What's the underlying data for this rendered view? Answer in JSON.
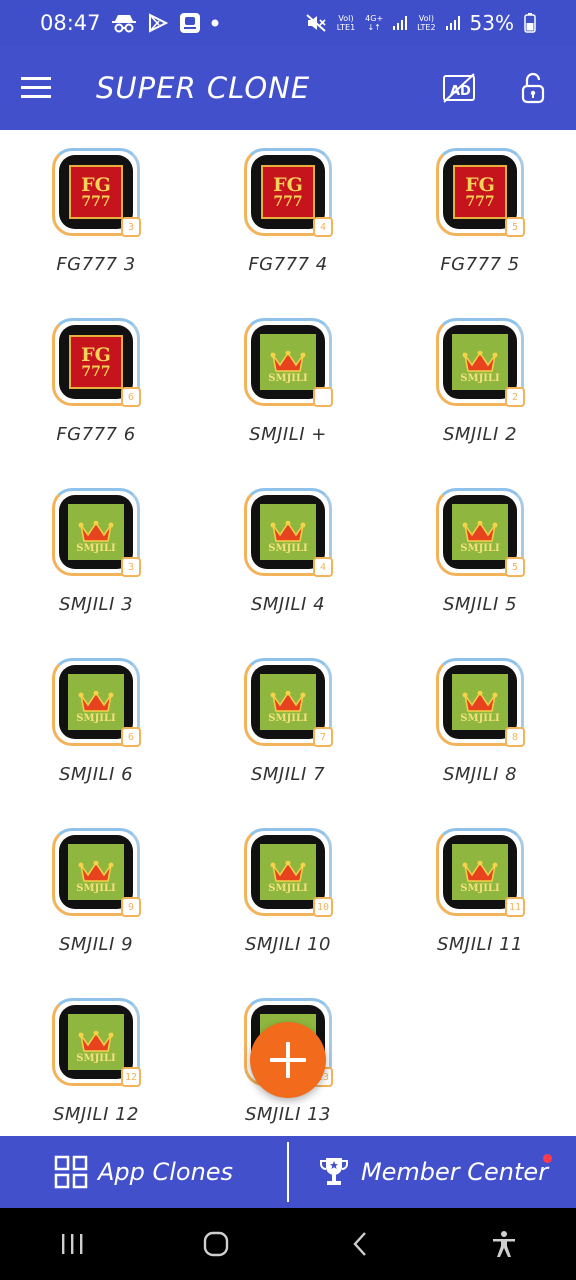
{
  "status_bar": {
    "time": "08:47",
    "left_icons": [
      "incognito-icon",
      "play-store-icon",
      "app-notification-icon",
      "dot-icon"
    ],
    "sim1": [
      "VoI)",
      "LTE1"
    ],
    "net_type": "4G+",
    "sim2": [
      "VoI)",
      "LTE2"
    ],
    "battery": "53%"
  },
  "app_bar": {
    "title": "SUPER CLONE",
    "actions": [
      "no-ads-icon",
      "lock-icon"
    ]
  },
  "apps": [
    {
      "label": "FG777 3",
      "logo": "fg",
      "badge": "3"
    },
    {
      "label": "FG777 4",
      "logo": "fg",
      "badge": "4"
    },
    {
      "label": "FG777 5",
      "logo": "fg",
      "badge": "5"
    },
    {
      "label": "FG777 6",
      "logo": "fg",
      "badge": "6"
    },
    {
      "label": "SMJILI +",
      "logo": "sm",
      "badge": ""
    },
    {
      "label": "SMJILI 2",
      "logo": "sm",
      "badge": "2"
    },
    {
      "label": "SMJILI 3",
      "logo": "sm",
      "badge": "3"
    },
    {
      "label": "SMJILI 4",
      "logo": "sm",
      "badge": "4"
    },
    {
      "label": "SMJILI 5",
      "logo": "sm",
      "badge": "5"
    },
    {
      "label": "SMJILI 6",
      "logo": "sm",
      "badge": "6"
    },
    {
      "label": "SMJILI 7",
      "logo": "sm",
      "badge": "7"
    },
    {
      "label": "SMJILI 8",
      "logo": "sm",
      "badge": "8"
    },
    {
      "label": "SMJILI 9",
      "logo": "sm",
      "badge": "9"
    },
    {
      "label": "SMJILI 10",
      "logo": "sm",
      "badge": "10"
    },
    {
      "label": "SMJILI 11",
      "logo": "sm",
      "badge": "11"
    },
    {
      "label": "SMJILI 12",
      "logo": "sm",
      "badge": "12"
    },
    {
      "label": "SMJILI 13",
      "logo": "sm",
      "badge": "13"
    }
  ],
  "logos": {
    "fg": {
      "line1": "FG",
      "line2": "777"
    },
    "sm": {
      "text": "SMJILI"
    }
  },
  "fab": {
    "icon": "plus-icon"
  },
  "bottom_nav": {
    "app_clones": {
      "label": "App Clones",
      "icon": "grid-icon"
    },
    "member_center": {
      "label": "Member Center",
      "icon": "trophy-icon",
      "has_notification": true
    }
  },
  "system_nav": [
    "recents-icon",
    "home-icon",
    "back-icon",
    "accessibility-icon"
  ],
  "colors": {
    "primary": "#4350cc",
    "status_bar": "#3f4fc9",
    "fab": "#f26a1b",
    "notification_dot": "#ff3a4a",
    "frame_orange": "#f2b35a",
    "frame_blue": "#8fc2ea"
  }
}
